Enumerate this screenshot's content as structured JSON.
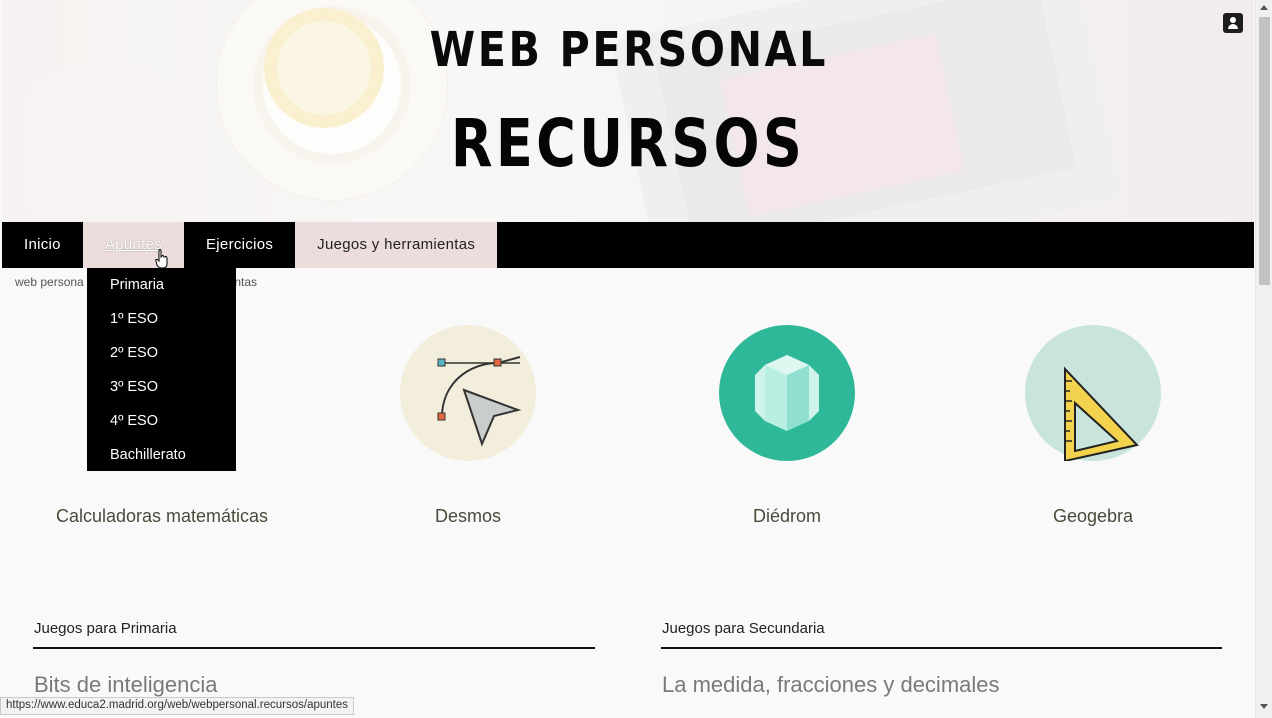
{
  "header": {
    "title_top": "WEB PERSONAL",
    "title_main": "RECURSOS"
  },
  "nav": {
    "items": [
      {
        "label": "Inicio"
      },
      {
        "label": "Apuntes"
      },
      {
        "label": "Ejercicios"
      },
      {
        "label": "Juegos y herramientas"
      }
    ]
  },
  "dropdown": {
    "items": [
      {
        "label": "Primaria"
      },
      {
        "label": "1º ESO"
      },
      {
        "label": "2º ESO"
      },
      {
        "label": "3º ESO"
      },
      {
        "label": "4º ESO"
      },
      {
        "label": "Bachillerato"
      }
    ]
  },
  "breadcrumb": {
    "start": "web persona",
    "end": "mientas"
  },
  "tiles": [
    {
      "label": "Calculadoras matemáticas",
      "icon": "calculator-icon"
    },
    {
      "label": "Desmos",
      "icon": "bezier-curve-icon"
    },
    {
      "label": "Diédrom",
      "icon": "hexagonal-prism-icon"
    },
    {
      "label": "Geogebra",
      "icon": "set-square-icon"
    }
  ],
  "sections": {
    "left_title": "Juegos para Primaria",
    "left_sub": "Bits de inteligencia",
    "right_title": "Juegos para Secundaria",
    "right_sub": "La medida, fracciones y decimales"
  },
  "status_url": "https://www.educa2.madrid.org/web/webpersonal.recursos/apuntes",
  "colors": {
    "nav_bg": "#000000",
    "nav_highlight": "#ecdcdc",
    "desmos_circle": "#f2eedb",
    "diedrom_circle": "#2fb79a",
    "geogebra_circle": "#c9e4dc"
  }
}
